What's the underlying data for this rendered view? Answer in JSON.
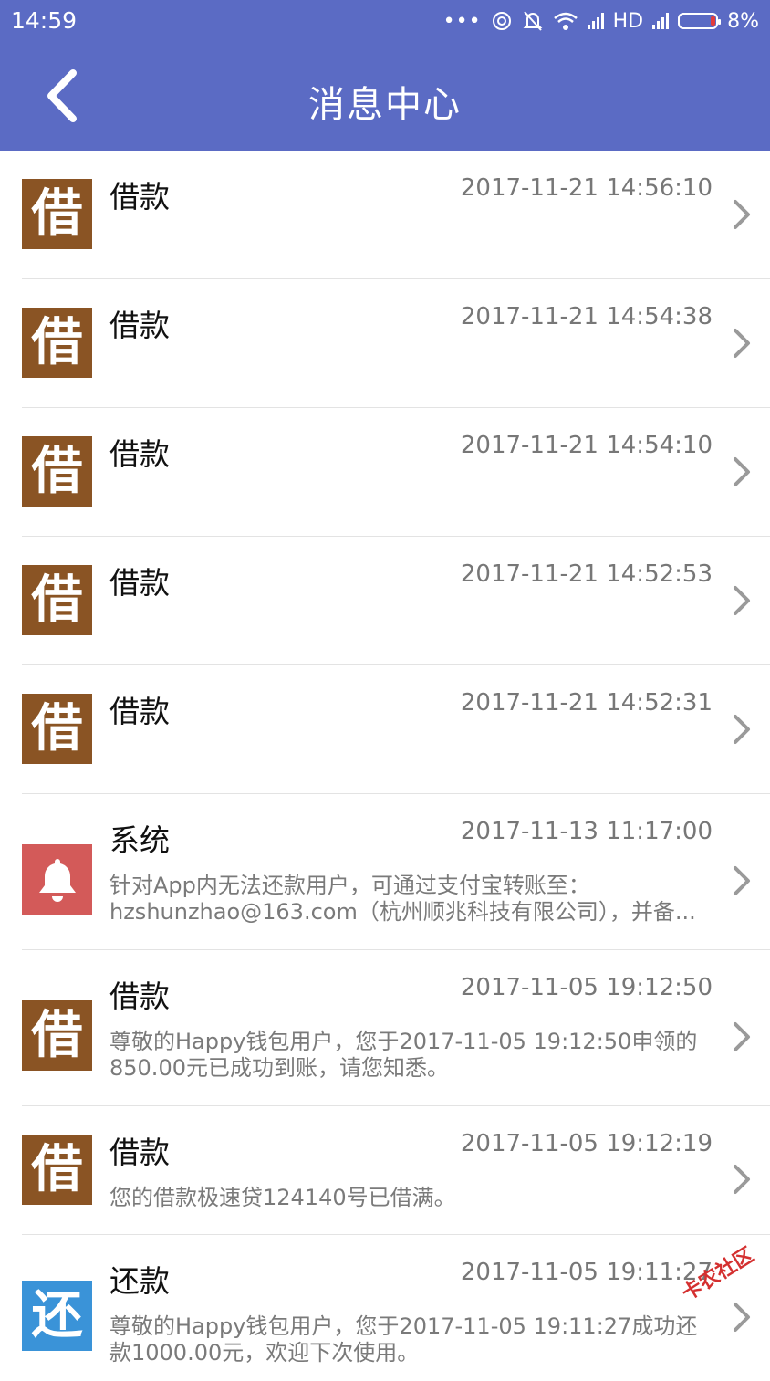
{
  "status_bar": {
    "time": "14:59",
    "network": "HD",
    "battery": "8%"
  },
  "header": {
    "title": "消息中心",
    "back_icon": "chevron-left-icon"
  },
  "colors": {
    "header_bg": "#5b6bc4",
    "loan_icon_bg": "#8a5424",
    "system_icon_bg": "#d35a59",
    "repay_icon_bg": "#3a93d8"
  },
  "messages": [
    {
      "type": "loan",
      "icon_text": "借",
      "title": "借款",
      "time": "2017-11-21 14:56:10",
      "body": ""
    },
    {
      "type": "loan",
      "icon_text": "借",
      "title": "借款",
      "time": "2017-11-21 14:54:38",
      "body": ""
    },
    {
      "type": "loan",
      "icon_text": "借",
      "title": "借款",
      "time": "2017-11-21 14:54:10",
      "body": ""
    },
    {
      "type": "loan",
      "icon_text": "借",
      "title": "借款",
      "time": "2017-11-21 14:52:53",
      "body": ""
    },
    {
      "type": "loan",
      "icon_text": "借",
      "title": "借款",
      "time": "2017-11-21 14:52:31",
      "body": ""
    },
    {
      "type": "system",
      "icon_text": "",
      "title": "系统",
      "time": "2017-11-13 11:17:00",
      "body": "针对App内无法还款用户，可通过支付宝转账至：hzshunzhao@163.com（杭州顺兆科技有限公司），并备..."
    },
    {
      "type": "loan",
      "icon_text": "借",
      "title": "借款",
      "time": "2017-11-05 19:12:50",
      "body": "尊敬的Happy钱包用户，您于2017-11-05 19:12:50申领的850.00元已成功到账，请您知悉。"
    },
    {
      "type": "loan",
      "icon_text": "借",
      "title": "借款",
      "time": "2017-11-05 19:12:19",
      "body": "您的借款极速贷124140号已借满。"
    },
    {
      "type": "repay",
      "icon_text": "还",
      "title": "还款",
      "time": "2017-11-05 19:11:27",
      "body": "尊敬的Happy钱包用户，您于2017-11-05 19:11:27成功还款1000.00元，欢迎下次使用。"
    }
  ],
  "watermark": "卡农社区"
}
